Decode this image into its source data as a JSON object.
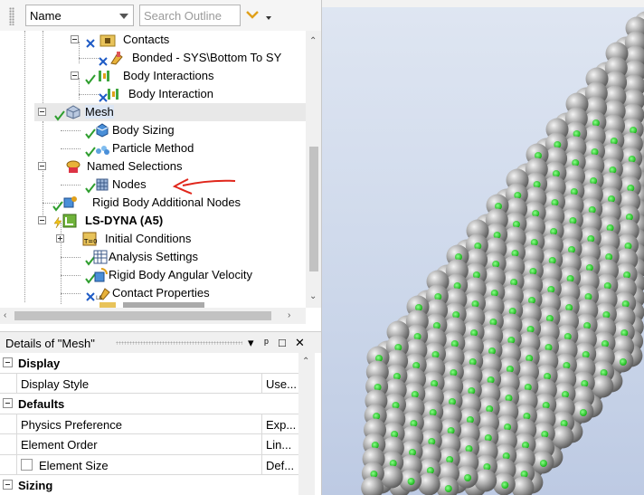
{
  "toolbar": {
    "name_select": "Name",
    "search_placeholder": "Search Outline"
  },
  "tree": {
    "items": [
      {
        "label": "Contacts",
        "bold": false
      },
      {
        "label": "Bonded - SYS\\Bottom To SY",
        "bold": false
      },
      {
        "label": "Body Interactions",
        "bold": false
      },
      {
        "label": "Body Interaction",
        "bold": false
      },
      {
        "label": "Mesh",
        "bold": false
      },
      {
        "label": "Body Sizing",
        "bold": false
      },
      {
        "label": "Particle Method",
        "bold": false
      },
      {
        "label": "Named Selections",
        "bold": false
      },
      {
        "label": "Nodes",
        "bold": false
      },
      {
        "label": "Rigid Body Additional Nodes",
        "bold": false
      },
      {
        "label": "LS-DYNA (A5)",
        "bold": true
      },
      {
        "label": "Initial Conditions",
        "bold": false
      },
      {
        "label": "Analysis Settings",
        "bold": false
      },
      {
        "label": "Rigid Body Angular Velocity",
        "bold": false
      },
      {
        "label": "Contact Properties",
        "bold": false
      }
    ]
  },
  "details": {
    "title": "Details of \"Mesh\"",
    "header_buttons": [
      "▾",
      "ᵖ",
      "□",
      "✕"
    ],
    "rows": [
      {
        "type": "section",
        "label": "Display"
      },
      {
        "type": "prop",
        "key": "Display Style",
        "value": "Use..."
      },
      {
        "type": "section",
        "label": "Defaults"
      },
      {
        "type": "prop",
        "key": "Physics Preference",
        "value": "Exp..."
      },
      {
        "type": "prop",
        "key": "Element Order",
        "value": "Lin..."
      },
      {
        "type": "prop",
        "key": "Element Size",
        "value": "Def...",
        "checkbox": true
      },
      {
        "type": "section",
        "label": "Sizing"
      }
    ]
  },
  "colors": {
    "check_green": "#2e9e2e",
    "x_blue": "#1e5bc6",
    "annotation_red": "#e0261b",
    "sphere_gray": "#a8a8a8",
    "node_green": "#2bd52b",
    "viewport_bg_top": "#dfe6f2",
    "viewport_bg_bottom": "#bdcae3"
  }
}
